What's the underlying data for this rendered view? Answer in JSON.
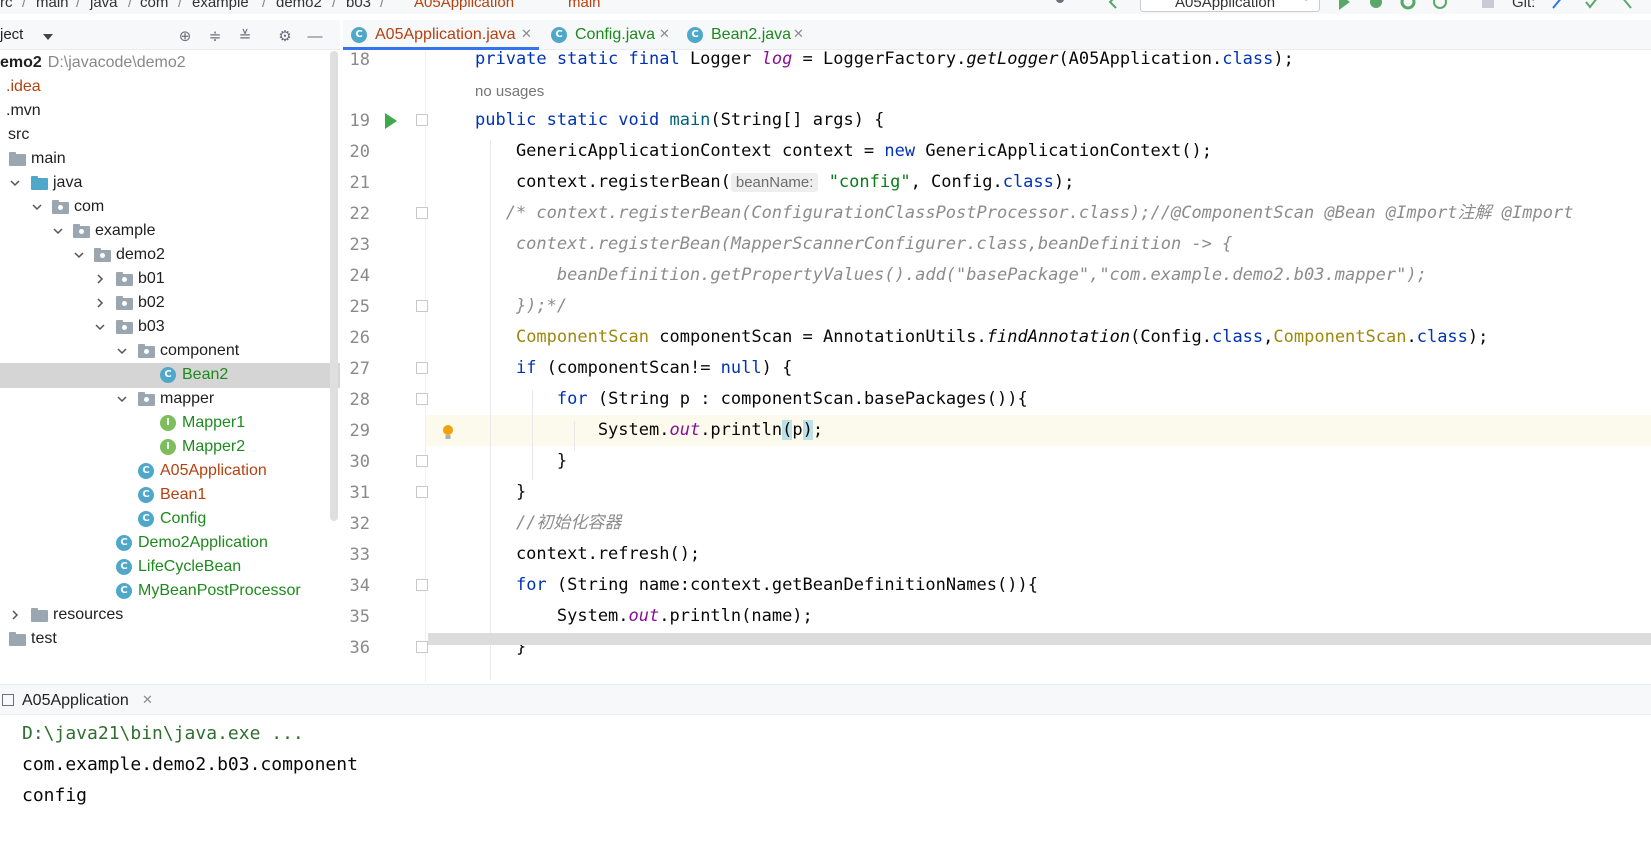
{
  "navbar": {
    "crumbs": [
      "rc",
      "main",
      "java",
      "com",
      "example",
      "demo2",
      "b03",
      "A05Application",
      "main"
    ],
    "run_config": "A05Application",
    "git_label": "Git:"
  },
  "project": {
    "header_title": "ject",
    "tree": [
      {
        "label": "emo2",
        "path": "D:\\javacode\\demo2"
      },
      {
        "label": ".idea"
      },
      {
        "label": ".mvn"
      },
      {
        "label": "src"
      },
      {
        "label": "main"
      },
      {
        "label": "java"
      },
      {
        "label": "com"
      },
      {
        "label": "example"
      },
      {
        "label": "demo2"
      },
      {
        "label": "b01"
      },
      {
        "label": "b02"
      },
      {
        "label": "b03"
      },
      {
        "label": "component"
      },
      {
        "label": "Bean2"
      },
      {
        "label": "mapper"
      },
      {
        "label": "Mapper1"
      },
      {
        "label": "Mapper2"
      },
      {
        "label": "A05Application"
      },
      {
        "label": "Bean1"
      },
      {
        "label": "Config"
      },
      {
        "label": "Demo2Application"
      },
      {
        "label": "LifeCycleBean"
      },
      {
        "label": "MyBeanPostProcessor"
      },
      {
        "label": "resources"
      },
      {
        "label": "test"
      }
    ]
  },
  "editor": {
    "tabs": [
      {
        "label": "A05Application.java"
      },
      {
        "label": "Config.java"
      },
      {
        "label": "Bean2.java"
      }
    ],
    "usages_hint": "no usages",
    "param_hint": "beanName:",
    "line_numbers": [
      "18",
      "19",
      "20",
      "21",
      "22",
      "23",
      "24",
      "25",
      "26",
      "27",
      "28",
      "29",
      "30",
      "31",
      "32",
      "33",
      "34",
      "35",
      "36"
    ],
    "code": {
      "l18_a": "private static final ",
      "l18_b": "Logger ",
      "l18_c": "log",
      "l18_d": " = LoggerFactory.",
      "l18_e": "getLogger",
      "l18_f": "(A05Application.",
      "l18_g": "class",
      "l18_h": ");",
      "l19_a": "public static void ",
      "l19_b": "main",
      "l19_c": "(String[] args) {",
      "l20_a": "    GenericApplicationContext context = ",
      "l20_b": "new",
      "l20_c": " GenericApplicationContext();",
      "l21_a": "    context.registerBean(",
      "l21_b": "\"config\"",
      "l21_c": ", Config.",
      "l21_d": "class",
      "l21_e": ");",
      "l22": "   /* context.registerBean(ConfigurationClassPostProcessor.class);//@ComponentScan @Bean @Import注解 @Import",
      "l23": "    context.registerBean(MapperScannerConfigurer.class,beanDefinition -> {",
      "l24": "        beanDefinition.getPropertyValues().add(\"basePackage\",\"com.example.demo2.b03.mapper\");",
      "l25": "    });*/",
      "l26_a": "    ",
      "l26_b": "ComponentScan",
      "l26_c": " componentScan = AnnotationUtils.",
      "l26_d": "findAnnotation",
      "l26_e": "(Config.",
      "l26_f": "class",
      "l26_g": ",",
      "l26_h": "ComponentScan",
      "l26_i": ".",
      "l26_j": "class",
      "l26_k": ");",
      "l27_a": "    ",
      "l27_b": "if",
      "l27_c": " (componentScan!= ",
      "l27_d": "null",
      "l27_e": ") {",
      "l28_a": "        ",
      "l28_b": "for",
      "l28_c": " (String p : componentScan.basePackages()){",
      "l29_a": "            System.",
      "l29_b": "out",
      "l29_c": ".println",
      "l29_d": "(",
      "l29_e": "p",
      "l29_f": ")",
      "l29_g": ";",
      "l30": "        }",
      "l31": "    }",
      "l32": "    //初始化容器",
      "l33": "    context.refresh();",
      "l34_a": "    ",
      "l34_b": "for",
      "l34_c": " (String name:context.getBeanDefinitionNames()){",
      "l35_a": "        System.",
      "l35_b": "out",
      "l35_c": ".println(name);",
      "l36": "    }"
    }
  },
  "run": {
    "tab_label": "A05Application",
    "console": [
      "D:\\java21\\bin\\java.exe ...",
      "com.example.demo2.b03.component",
      "config"
    ]
  },
  "colors": {
    "keyword": "#0033b3",
    "string": "#067d17",
    "comment": "#8c8c8c",
    "static_field": "#871094",
    "annotation": "#9e880d",
    "tree_green": "#1d8a1d",
    "tree_brown": "#b5420f",
    "selection": "#d5d5d5",
    "current_line": "#fcfaed"
  }
}
